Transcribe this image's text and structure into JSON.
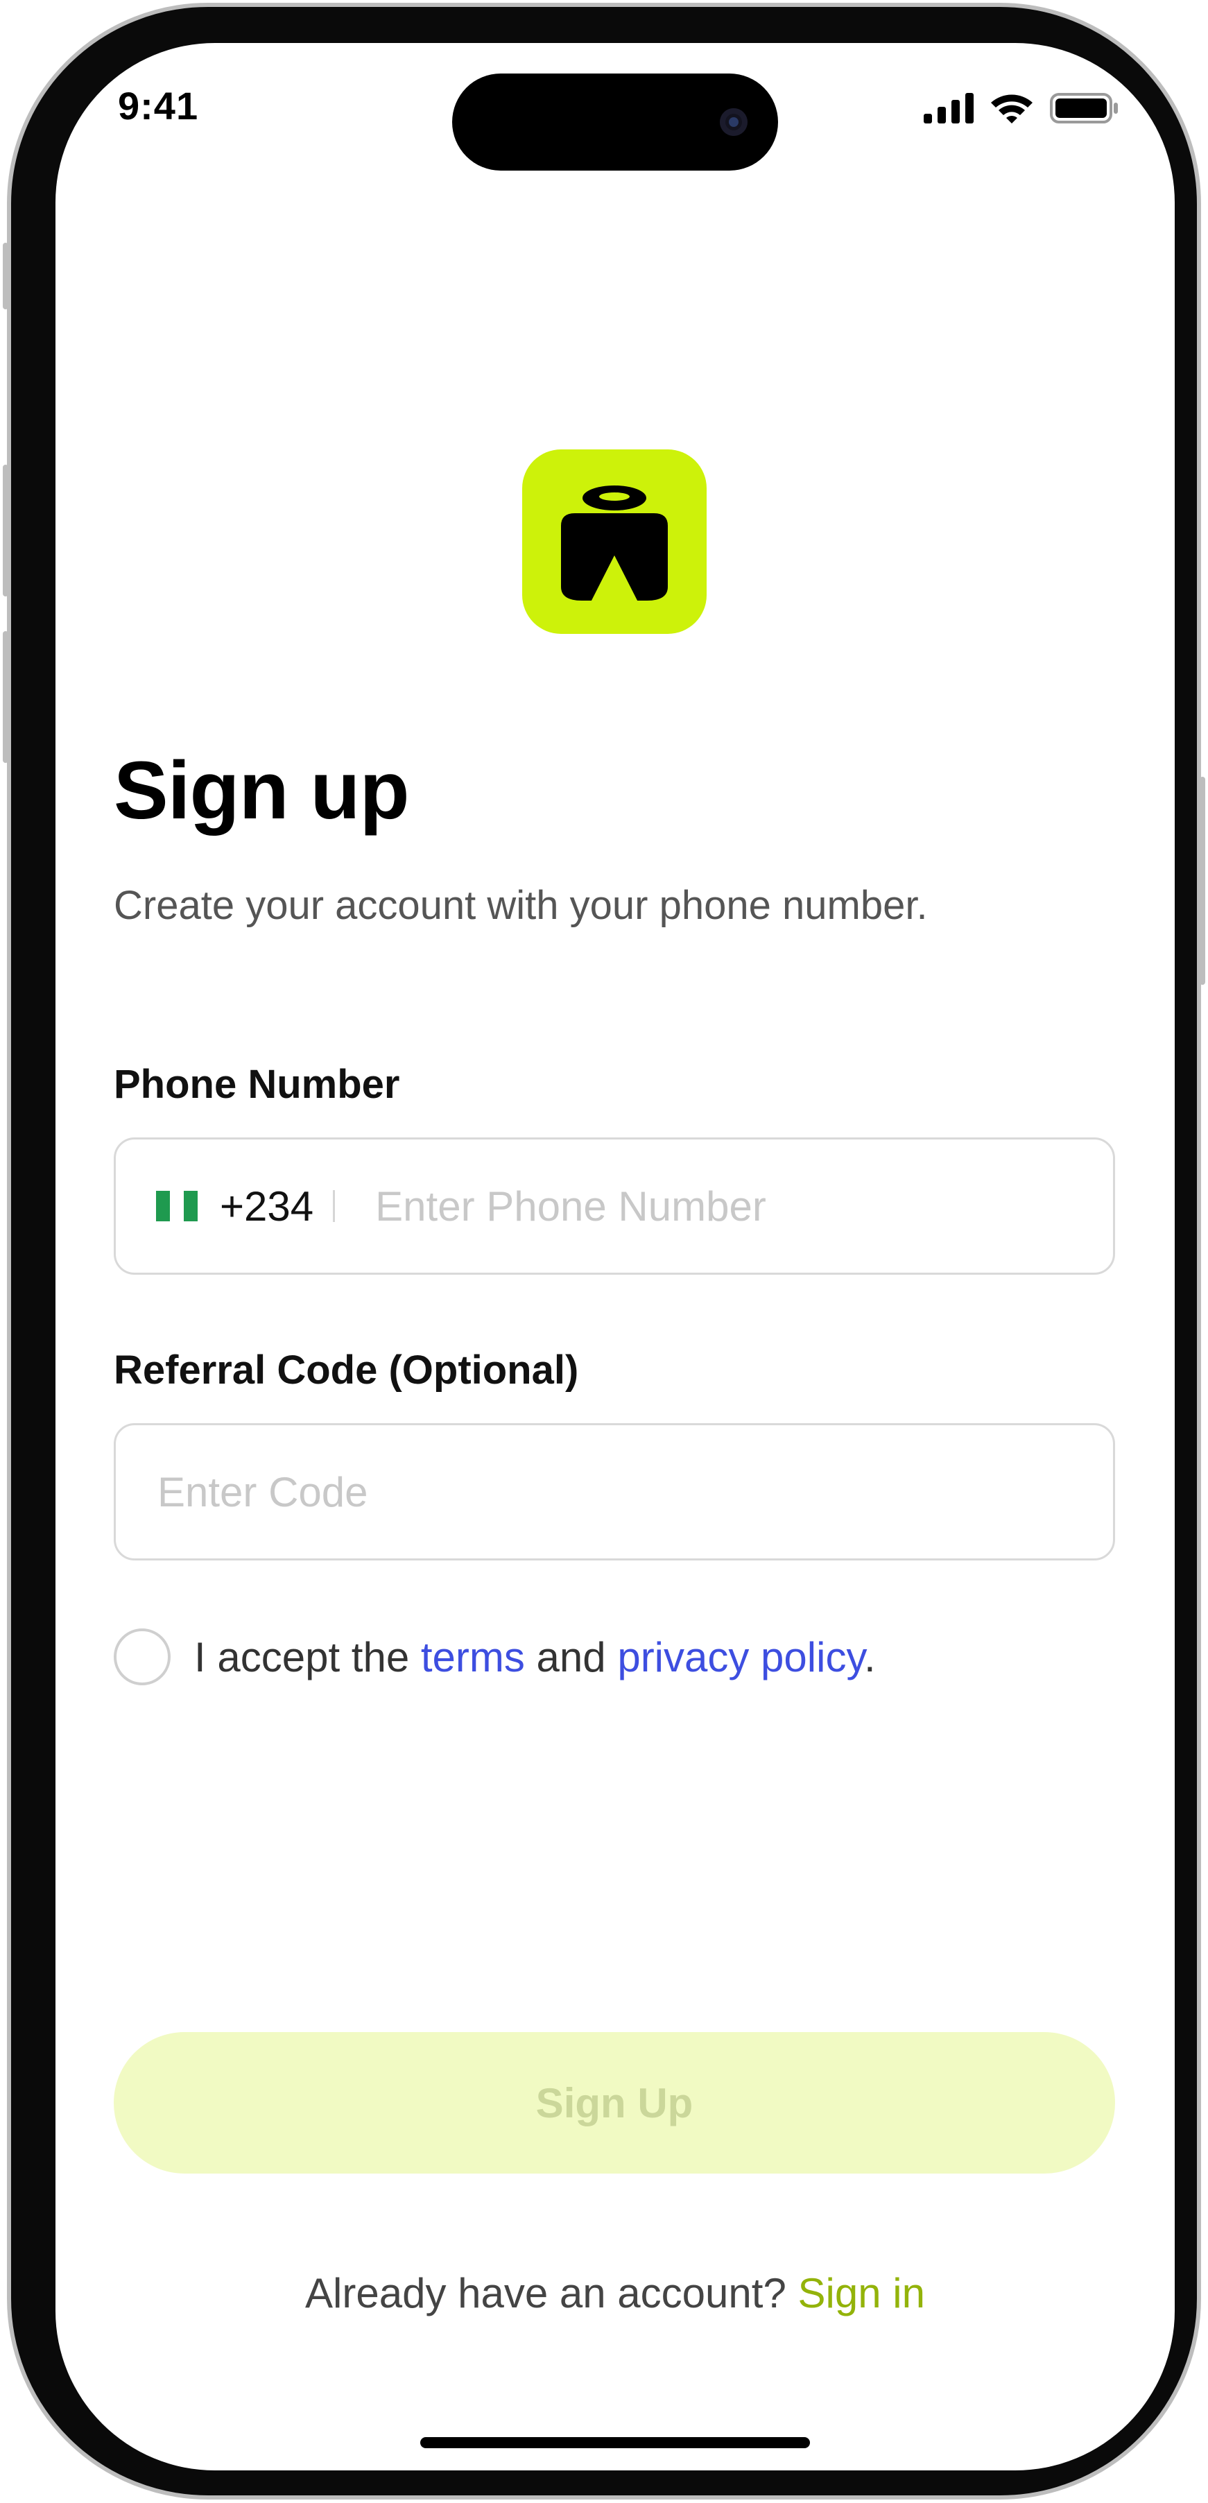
{
  "status_bar": {
    "time": "9:41",
    "icons": [
      "cellular-signal-icon",
      "wifi-icon",
      "battery-icon"
    ]
  },
  "app": {
    "logo_icon": "brand-m-logo-icon",
    "brand_color": "#cdf20a"
  },
  "signup": {
    "title": "Sign up",
    "subtitle": "Create your account with your phone number.",
    "phone": {
      "label": "Phone Number",
      "flag_icon": "nigeria-flag-icon",
      "dial_code": "+234",
      "placeholder": "Enter Phone Number",
      "value": ""
    },
    "referral": {
      "label": "Referral Code (Optional)",
      "placeholder": "Enter Code",
      "value": ""
    },
    "terms": {
      "checked": false,
      "prefix": "I accept the ",
      "terms_link": "terms",
      "middle": " and ",
      "privacy_link": "privacy policy",
      "suffix": ".",
      "link_color": "#3d4ee0"
    },
    "submit_label": "Sign Up",
    "signin_prompt": "Already have an account? ",
    "signin_link": "Sign in",
    "signin_link_color": "#93b30a"
  }
}
